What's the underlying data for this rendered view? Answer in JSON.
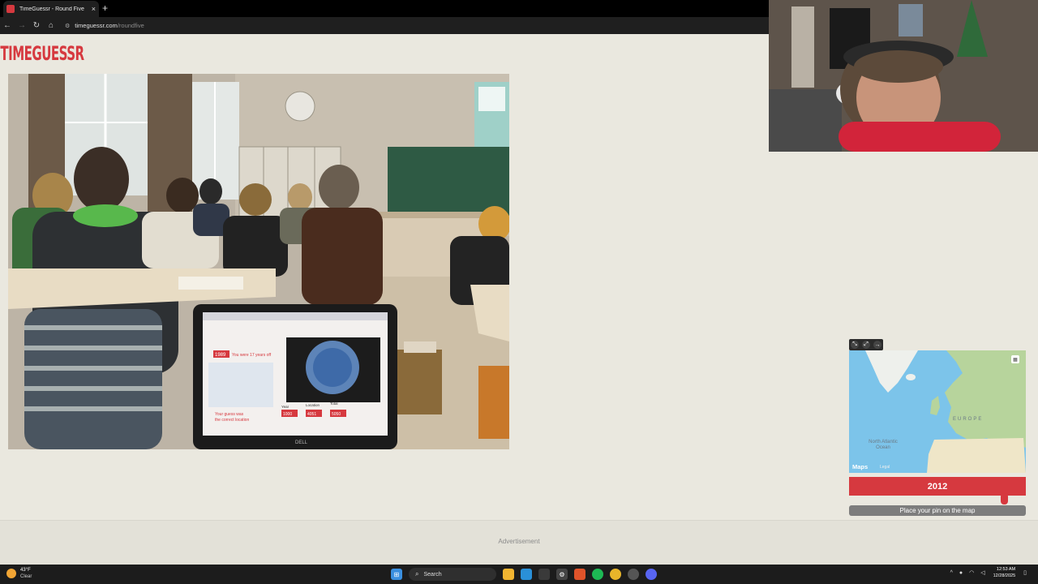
{
  "browser": {
    "tab_title": "TimeGuessr - Round Five",
    "tab_close": "×",
    "new_tab": "+",
    "url_domain": "timeguessr.com",
    "url_path": "/roundfive"
  },
  "page": {
    "logo": "TIMEGUESSR",
    "photo_laptop_brand": "DELL",
    "photo_screen": {
      "year_badge": "1989",
      "years_off": "You were 17 years off",
      "guess_text": "Your guess was",
      "guess_text_2": "the correct location",
      "year_label": "Year",
      "location_label": "Location",
      "total_label": "Total",
      "year_score": "1000",
      "location_score": "4051",
      "total_score": "5050"
    },
    "map": {
      "label_europe": "EUROPE",
      "label_ocean": "North Atlantic Ocean",
      "maps_logo": "Maps",
      "legal": "Legal"
    },
    "year_value": "2012",
    "year_fraction": 0.88,
    "pin_button": "Place your pin on the map",
    "advertisement": "Advertisement"
  },
  "taskbar": {
    "temperature": "43°F",
    "condition": "Clear",
    "search_label": "Search",
    "time": "12:53 AM",
    "date": "12/28/2025"
  }
}
